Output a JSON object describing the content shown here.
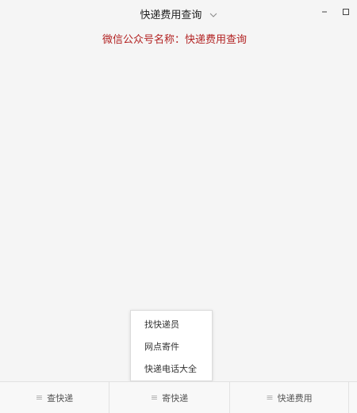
{
  "window": {
    "title": "快递费用查询",
    "minimize_glyph": "–",
    "maximize_glyph": "□"
  },
  "account_name_text": "微信公众号名称：快递费用查询",
  "popup_menu": {
    "items": [
      "找快递员",
      "网点寄件",
      "快递电话大全"
    ]
  },
  "bottom_menu": {
    "tabs": [
      {
        "label": "查快递",
        "icon": "menu-lines-icon"
      },
      {
        "label": "寄快递",
        "icon": "menu-lines-icon"
      },
      {
        "label": "快递费用",
        "icon": "menu-lines-icon"
      }
    ]
  },
  "colors": {
    "account_name": "#b22222",
    "background": "#f5f5f5",
    "popup_bg": "#ffffff",
    "bottom_menu_bg": "#f8f8f8"
  }
}
